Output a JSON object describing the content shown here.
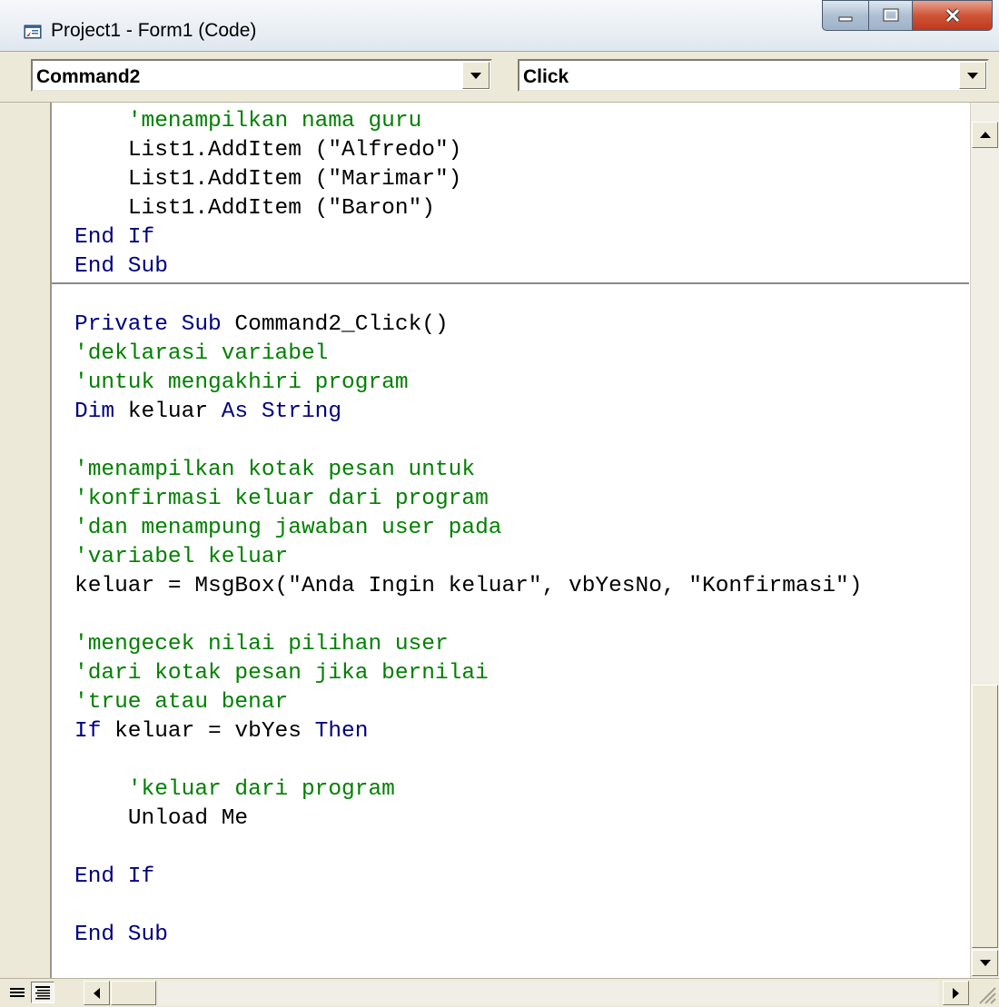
{
  "window": {
    "title": "Project1 - Form1 (Code)",
    "icon": "vb-code-window-icon",
    "buttons": [
      "minimize-icon",
      "maximize-icon",
      "close-icon"
    ]
  },
  "object_combo": {
    "value": "Command2"
  },
  "procedure_combo": {
    "value": "Click"
  },
  "code_lines": [
    {
      "indent": "    ",
      "text": "'menampilkan nama guru",
      "kind": "comment"
    },
    {
      "indent": "    ",
      "text": "List1.AddItem (\"Alfredo\")",
      "kind": "plain"
    },
    {
      "indent": "    ",
      "text": "List1.AddItem (\"Marimar\")",
      "kind": "plain"
    },
    {
      "indent": "    ",
      "text": "List1.AddItem (\"Baron\")",
      "kind": "plain"
    },
    {
      "indent": "",
      "text": "End If",
      "kind": "keyword"
    },
    {
      "indent": "",
      "text": "End Sub",
      "kind": "keyword"
    },
    {
      "indent": "",
      "text": "",
      "kind": "blank"
    },
    {
      "indent": "",
      "kind": "mixed",
      "parts": [
        {
          "t": "Private Sub",
          "k": "kw"
        },
        {
          "t": " Command2_Click()",
          "k": "plain"
        }
      ]
    },
    {
      "indent": "",
      "text": "'deklarasi variabel",
      "kind": "comment"
    },
    {
      "indent": "",
      "text": "'untuk mengakhiri program",
      "kind": "comment"
    },
    {
      "indent": "",
      "kind": "mixed",
      "parts": [
        {
          "t": "Dim",
          "k": "kw"
        },
        {
          "t": " keluar ",
          "k": "plain"
        },
        {
          "t": "As String",
          "k": "kw"
        }
      ]
    },
    {
      "indent": "",
      "text": "",
      "kind": "blank"
    },
    {
      "indent": "",
      "text": "'menampilkan kotak pesan untuk",
      "kind": "comment"
    },
    {
      "indent": "",
      "text": "'konfirmasi keluar dari program",
      "kind": "comment"
    },
    {
      "indent": "",
      "text": "'dan menampung jawaban user pada",
      "kind": "comment"
    },
    {
      "indent": "",
      "text": "'variabel keluar",
      "kind": "comment"
    },
    {
      "indent": "",
      "text": "keluar = MsgBox(\"Anda Ingin keluar\", vbYesNo, \"Konfirmasi\")",
      "kind": "plain"
    },
    {
      "indent": "",
      "text": "",
      "kind": "blank"
    },
    {
      "indent": "",
      "text": "'mengecek nilai pilihan user",
      "kind": "comment"
    },
    {
      "indent": "",
      "text": "'dari kotak pesan jika bernilai",
      "kind": "comment"
    },
    {
      "indent": "",
      "text": "'true atau benar",
      "kind": "comment"
    },
    {
      "indent": "",
      "kind": "mixed",
      "parts": [
        {
          "t": "If",
          "k": "kw"
        },
        {
          "t": " keluar = vbYes ",
          "k": "plain"
        },
        {
          "t": "Then",
          "k": "kw"
        }
      ]
    },
    {
      "indent": "",
      "text": "",
      "kind": "blank"
    },
    {
      "indent": "    ",
      "text": "'keluar dari program",
      "kind": "comment"
    },
    {
      "indent": "    ",
      "text": "Unload Me",
      "kind": "plain"
    },
    {
      "indent": "",
      "text": "",
      "kind": "blank"
    },
    {
      "indent": "",
      "text": "End If",
      "kind": "keyword"
    },
    {
      "indent": "",
      "text": "",
      "kind": "blank"
    },
    {
      "indent": "",
      "text": "End Sub",
      "kind": "keyword"
    }
  ],
  "scrollbars": {
    "vertical": {
      "up_icon": "scroll-up-arrow-icon",
      "down_icon": "scroll-down-arrow-icon"
    },
    "horizontal": {
      "left_icon": "scroll-left-arrow-icon",
      "right_icon": "scroll-right-arrow-icon"
    }
  },
  "view_buttons": [
    "procedure-view-icon",
    "full-module-view-icon"
  ],
  "colors": {
    "comment": "#008000",
    "keyword": "#000080",
    "plain": "#000000",
    "chrome": "#ece9d8",
    "close_button": "#c0391d"
  }
}
